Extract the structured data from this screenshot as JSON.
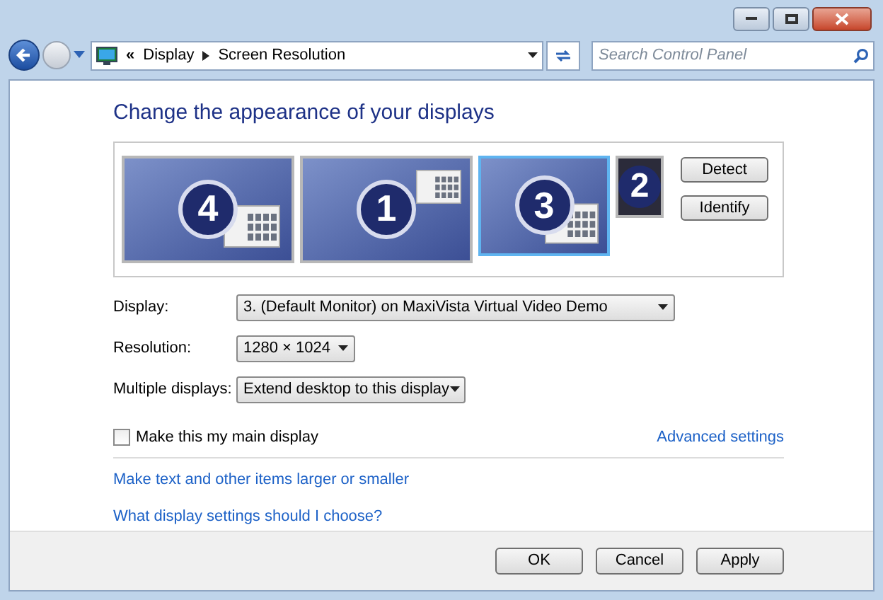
{
  "address_bar": {
    "overflow": "«",
    "crumbs": [
      "Display",
      "Screen Resolution"
    ]
  },
  "search": {
    "placeholder": "Search Control Panel"
  },
  "heading": "Change the appearance of your displays",
  "monitors": [
    {
      "number": "4",
      "selected": false,
      "kind": "large"
    },
    {
      "number": "1",
      "selected": false,
      "kind": "main"
    },
    {
      "number": "3",
      "selected": true,
      "kind": "medium"
    },
    {
      "number": "2",
      "selected": false,
      "kind": "small"
    }
  ],
  "side_buttons": [
    "Detect",
    "Identify"
  ],
  "fields": [
    {
      "label": "Display:",
      "value": "3. (Default Monitor) on MaxiVista Virtual Video Demo",
      "kind": "wide"
    },
    {
      "label": "Resolution:",
      "value": "1280 × 1024",
      "kind": "narrow"
    },
    {
      "label": "Multiple displays:",
      "value": "Extend desktop to this display",
      "kind": "medium"
    }
  ],
  "main_display": {
    "label": "Make this my main display",
    "checked": false
  },
  "advanced_link": "Advanced settings",
  "links": [
    "Make text and other items larger or smaller",
    "What display settings should I choose?"
  ],
  "buttons": [
    "OK",
    "Cancel",
    "Apply"
  ]
}
